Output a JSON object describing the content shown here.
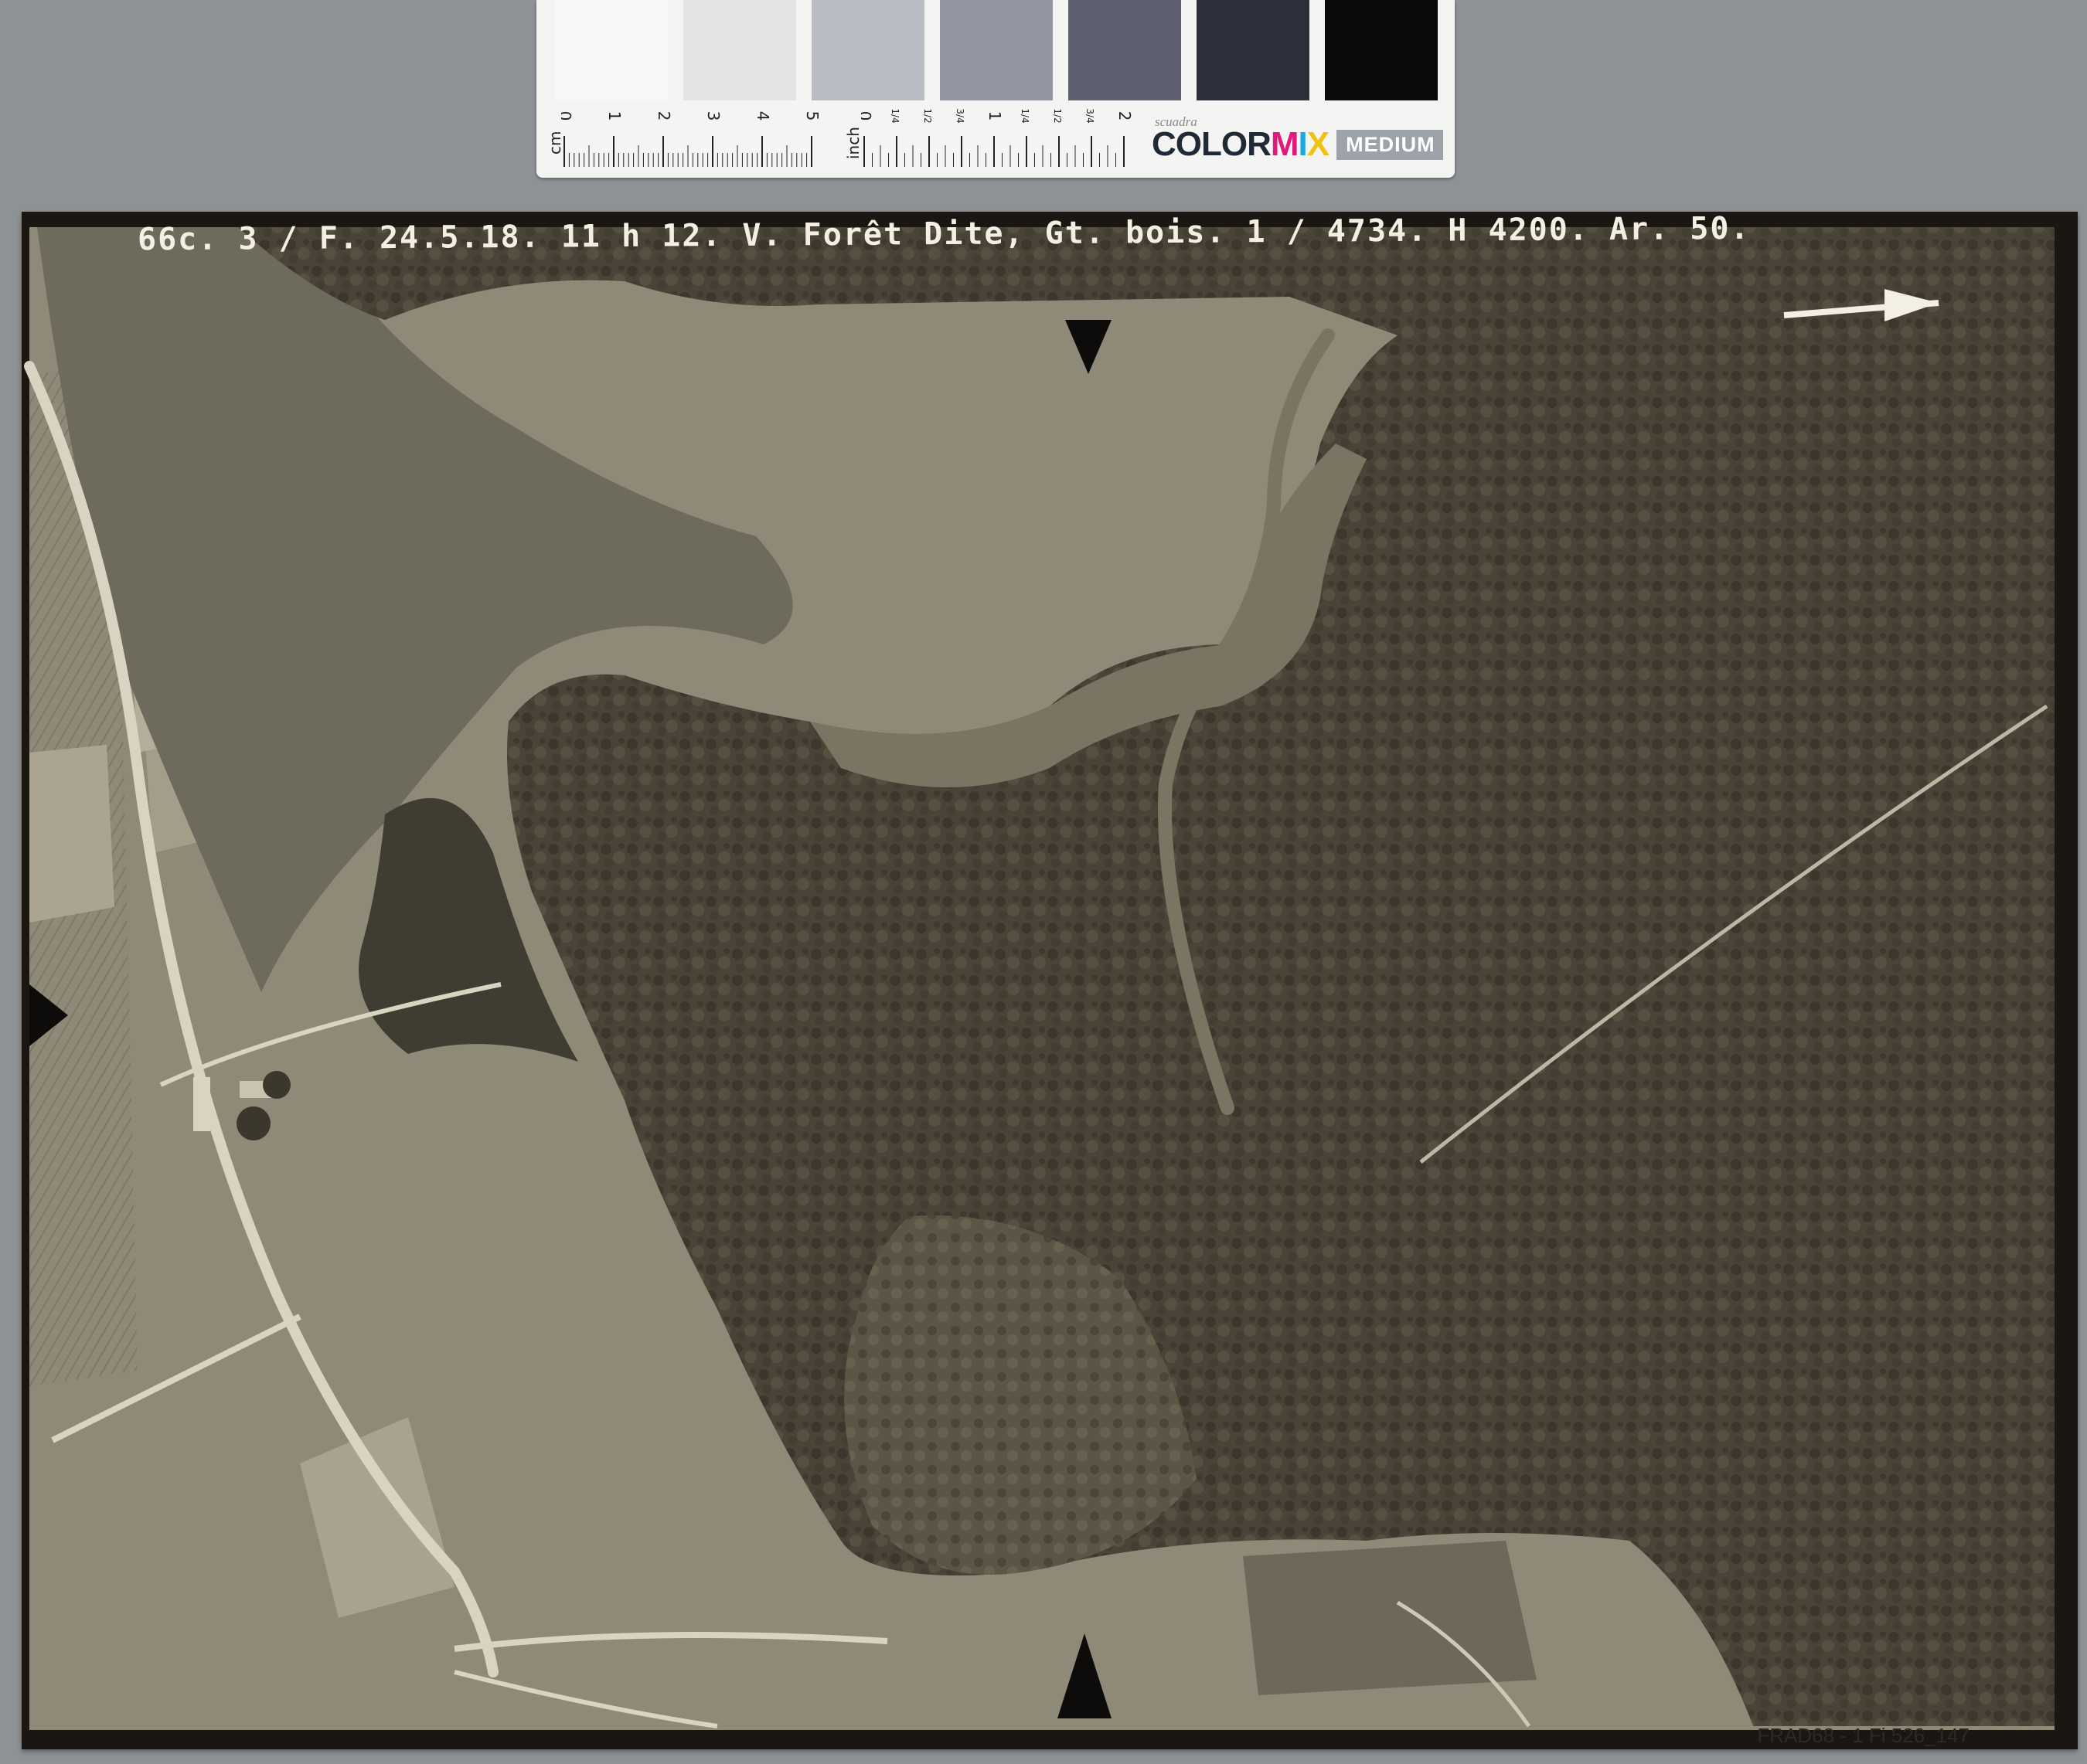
{
  "color_card": {
    "patches": [
      "#f7f7f5",
      "#e4e4e6",
      "#babcc4",
      "#9396a1",
      "#5e6070",
      "#2c303b",
      "#0a0a0b"
    ],
    "cm_label": "cm",
    "inch_label": "inch",
    "cm_ticks": [
      "0",
      "1",
      "2",
      "3",
      "4",
      "5"
    ],
    "inch_ticks": [
      "0",
      "1/4",
      "1/2",
      "3/4",
      "1",
      "1/4",
      "1/2",
      "3/4",
      "2"
    ],
    "brand_small": "scuadra",
    "brand_main": {
      "a": "COLOR",
      "b": "M",
      "c": "I",
      "d": "X"
    },
    "brand_sub": "MEDIUM"
  },
  "photograph": {
    "caption": "66c. 3 / F. 24.5.18. 11 h 12. V. Forêt Dite, Gt. bois. 1 / 4734. H 4200. Ar. 50.",
    "archive_reference": "FRAD68 - 1 Fi 526_147",
    "colors": {
      "forest": "#494437",
      "forest_dark": "#3b372c",
      "lake": "#6e6a5c",
      "fields": "#8f8a78",
      "light_field": "#b3ad99",
      "roads": "#d9d3c2",
      "border": "#1a1712"
    }
  }
}
